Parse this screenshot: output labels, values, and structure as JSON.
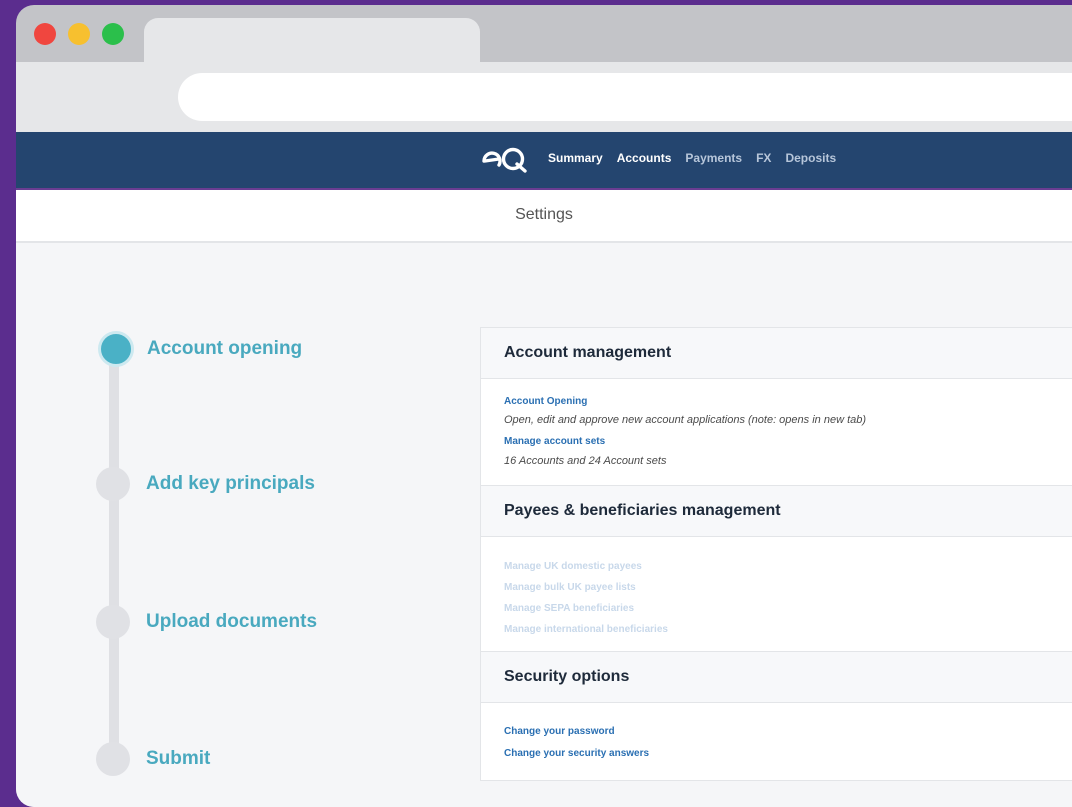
{
  "nav": {
    "logo_text": "eQ",
    "links": [
      "Summary",
      "Accounts",
      "Payments",
      "FX",
      "Deposits"
    ]
  },
  "subheader": {
    "title": "Settings"
  },
  "stepper": {
    "steps": [
      "Account opening",
      "Add key principals",
      "Upload documents",
      "Submit"
    ],
    "active_index": 0
  },
  "panel": {
    "account_management": {
      "title": "Account management",
      "account_opening_link": "Account Opening",
      "account_opening_desc": "Open, edit and approve new account applications (note: opens in new tab)",
      "manage_sets_link": "Manage account sets",
      "manage_sets_desc": "16 Accounts and 24 Account sets"
    },
    "payees": {
      "title": "Payees & beneficiaries management",
      "links": [
        "Manage UK domestic payees",
        "Manage bulk UK payee lists",
        "Manage SEPA beneficiaries",
        "Manage international beneficiaries"
      ]
    },
    "security": {
      "title": "Security options",
      "links": [
        "Change your password",
        "Change your security answers"
      ]
    }
  },
  "colors": {
    "background": "#5b2d8e",
    "navbar": "#24456f",
    "accent": "#4ab1c6",
    "link": "#2a6fb2"
  }
}
